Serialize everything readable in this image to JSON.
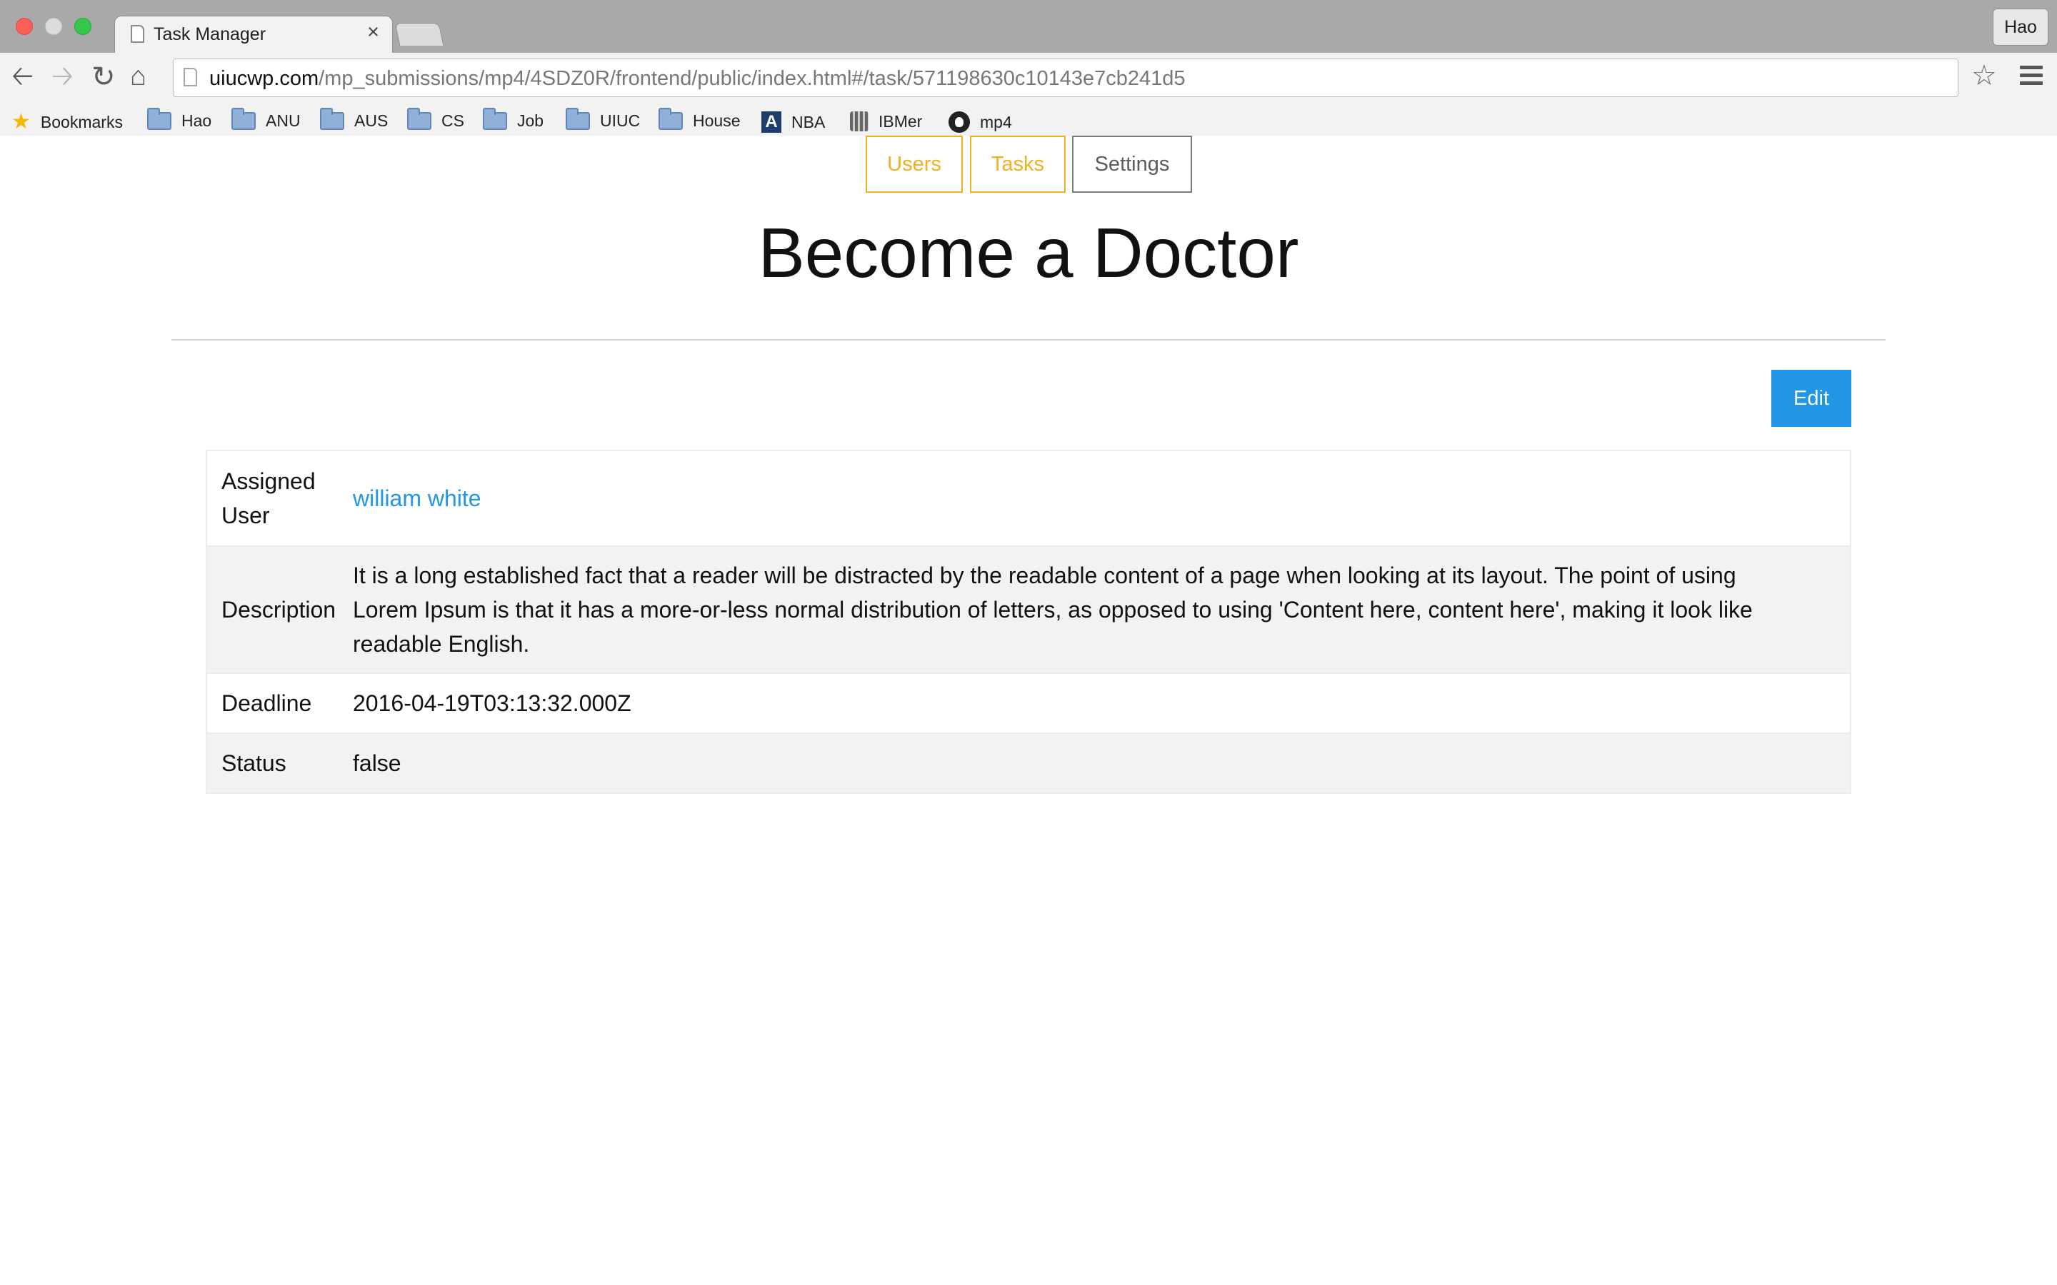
{
  "browser": {
    "tab_title": "Task Manager",
    "tab_close": "×",
    "profile": "Hao",
    "url_domain": "uiucwp.com",
    "url_path": "/mp_submissions/mp4/4SDZ0R/frontend/public/index.html#/task/571198630c10143e7cb241d5",
    "bookmarks": [
      {
        "label": "Bookmarks",
        "icon": "star-icon"
      },
      {
        "label": "Hao",
        "icon": "folder-icon"
      },
      {
        "label": "ANU",
        "icon": "folder-icon"
      },
      {
        "label": "AUS",
        "icon": "folder-icon"
      },
      {
        "label": "CS",
        "icon": "folder-icon"
      },
      {
        "label": "Job",
        "icon": "folder-icon"
      },
      {
        "label": "UIUC",
        "icon": "folder-icon"
      },
      {
        "label": "House",
        "icon": "folder-icon"
      },
      {
        "label": "NBA",
        "icon": "a-logo-icon"
      },
      {
        "label": "IBMer",
        "icon": "ibm-icon"
      },
      {
        "label": "mp4",
        "icon": "github-icon"
      }
    ]
  },
  "nav": {
    "users": "Users",
    "tasks": "Tasks",
    "settings": "Settings"
  },
  "task": {
    "title": "Become a Doctor",
    "edit_label": "Edit",
    "rows": [
      {
        "label": "Assigned\nUser",
        "value": "william white"
      },
      {
        "label": "Description",
        "value": "It is a long established fact that a reader will be distracted by the readable content of a page when looking at its layout. The point of using Lorem Ipsum is that it has a more-or-less normal distribution of letters, as opposed to using 'Content here, content here', making it look like readable English."
      },
      {
        "label": "Deadline",
        "value": "2016-04-19T03:13:32.000Z"
      },
      {
        "label": "Status",
        "value": "false"
      }
    ]
  },
  "colors": {
    "accent": "#2196e4",
    "nav_border": "#f2b01e",
    "row_alt": "#f2f2f2"
  }
}
